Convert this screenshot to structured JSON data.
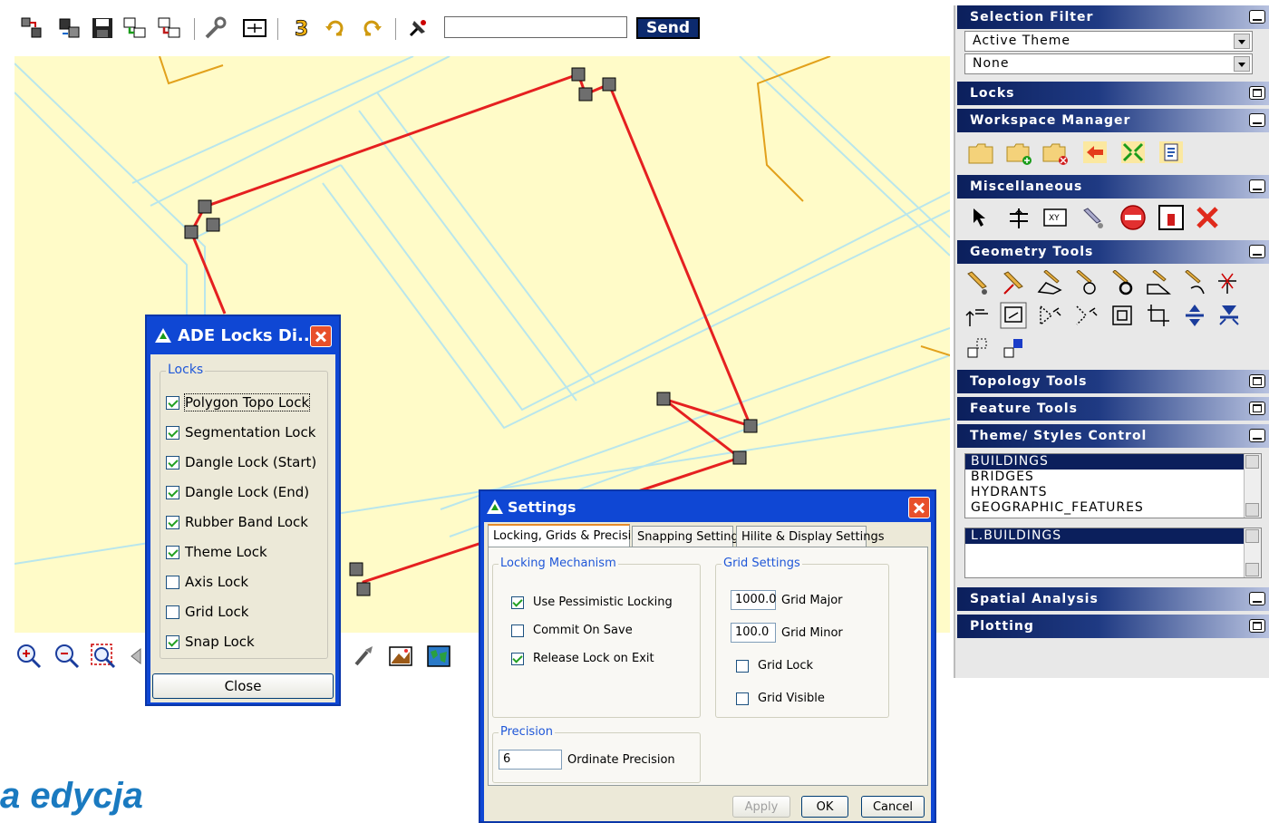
{
  "toolbar": {
    "send_label": "Send",
    "command_value": "",
    "icons": [
      "export-icon",
      "import-icon",
      "save-icon",
      "table-link-icon",
      "table-unlink-icon",
      "wrench-icon",
      "grid-icon",
      "redo-number-icon",
      "undo-icon",
      "redo-icon",
      "pin-icon"
    ]
  },
  "right_panel": {
    "selection_filter": {
      "title": "Selection Filter",
      "combo1": "Active Theme",
      "combo2": "None"
    },
    "locks": {
      "title": "Locks"
    },
    "workspace_manager": {
      "title": "Workspace Manager"
    },
    "miscellaneous": {
      "title": "Miscellaneous"
    },
    "geometry_tools": {
      "title": "Geometry Tools"
    },
    "topology_tools": {
      "title": "Topology Tools"
    },
    "feature_tools": {
      "title": "Feature Tools"
    },
    "theme_styles_control": {
      "title": "Theme/ Styles Control",
      "themes": [
        "BUILDINGS",
        "BRIDGES",
        "HYDRANTS",
        "GEOGRAPHIC_FEATURES"
      ],
      "styles": [
        "L.BUILDINGS"
      ]
    },
    "spatial_analysis": {
      "title": "Spatial Analysis"
    },
    "plotting": {
      "title": "Plotting"
    }
  },
  "locks_dialog": {
    "title": "ADE Locks Di...",
    "group_label": "Locks",
    "items": [
      {
        "label": "Polygon Topo Lock",
        "checked": true
      },
      {
        "label": "Segmentation Lock",
        "checked": true
      },
      {
        "label": "Dangle Lock (Start)",
        "checked": true
      },
      {
        "label": "Dangle Lock (End)",
        "checked": true
      },
      {
        "label": "Rubber Band Lock",
        "checked": true
      },
      {
        "label": "Theme Lock",
        "checked": true
      },
      {
        "label": "Axis Lock",
        "checked": false
      },
      {
        "label": "Grid Lock",
        "checked": false
      },
      {
        "label": "Snap Lock",
        "checked": true
      }
    ],
    "close_label": "Close"
  },
  "settings_dialog": {
    "title": "Settings",
    "tabs": [
      "Locking, Grids & Precision",
      "Snapping Settings",
      "Hilite & Display Settings"
    ],
    "locking_mechanism": {
      "label": "Locking Mechanism",
      "items": [
        {
          "label": "Use Pessimistic Locking",
          "checked": true
        },
        {
          "label": "Commit On Save",
          "checked": false
        },
        {
          "label": "Release Lock on Exit",
          "checked": true
        }
      ]
    },
    "grid_settings": {
      "label": "Grid Settings",
      "major_value": "1000.0",
      "major_label": "Grid Major",
      "minor_value": "100.0",
      "minor_label": "Grid Minor",
      "grid_lock_label": "Grid Lock",
      "grid_lock_checked": false,
      "grid_visible_label": "Grid Visible",
      "grid_visible_checked": false
    },
    "precision": {
      "label": "Precision",
      "value": "6",
      "field_label": "Ordinate Precision"
    },
    "apply_label": "Apply",
    "ok_label": "OK",
    "cancel_label": "Cancel"
  },
  "caption": "a edycja",
  "colors": {
    "map_bg": "#fffbc8",
    "road_line": "#b9e6ec",
    "parcel_line": "#e2a11c",
    "feature_line": "#e52020",
    "dialog_title": "#0f47d4",
    "panel_header": "#0b1f5c"
  }
}
